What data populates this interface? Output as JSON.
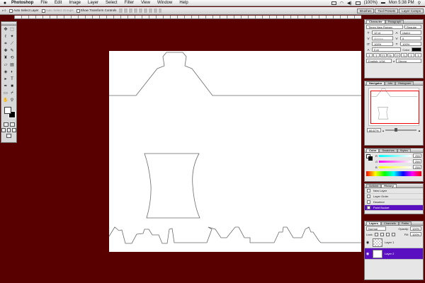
{
  "menubar": {
    "app_name": "Photoshop",
    "items": [
      "File",
      "Edit",
      "Image",
      "Layer",
      "Select",
      "Filter",
      "View",
      "Window",
      "Help"
    ],
    "battery": "(100%)",
    "clock": "Mon 5:38 PM"
  },
  "options_bar": {
    "auto_select_layer": "Auto Select Layer",
    "auto_select_groups": "Auto Select Groups",
    "show_transform_controls": "Show Transform Controls",
    "right_tabs": [
      "Brushes",
      "Tool Presets",
      "Layer Comps"
    ]
  },
  "toolbox": {
    "tool_icons": [
      "move-icon",
      "marquee-icon",
      "lasso-icon",
      "magic-wand-icon",
      "crop-icon",
      "slice-icon",
      "healing-icon",
      "brush-icon",
      "stamp-icon",
      "history-brush-icon",
      "eraser-icon",
      "gradient-icon",
      "blur-icon",
      "dodge-icon",
      "path-selection-icon",
      "type-icon",
      "pen-icon",
      "shape-icon",
      "notes-icon",
      "eyedropper-icon",
      "hand-icon",
      "zoom-icon"
    ],
    "foreground_color": "#ffffff",
    "background_color": "#000000"
  },
  "document": {
    "pasteboard_color": "#580000",
    "canvas_color": "#ffffff"
  },
  "character_panel": {
    "tabs": [
      "Character",
      "Paragraph"
    ],
    "font_family": "Times New Roman",
    "font_style": "Regular",
    "font_size": "12 pt",
    "leading": "(Auto)",
    "kerning": "Metrics",
    "tracking": "0",
    "vertical_scale": "100%",
    "horizontal_scale": "100%",
    "baseline_shift": "0 pt",
    "color_label": "Color:",
    "style_buttons": [
      "T",
      "T",
      "TT",
      "Tr",
      "T¹",
      "T₁",
      "T",
      "T"
    ],
    "language": "English: USA",
    "anti_alias_label": "a",
    "anti_alias": "Strong"
  },
  "navigator_panel": {
    "tabs": [
      "Navigator",
      "Info",
      "Histogram"
    ],
    "zoom": "66.67%"
  },
  "color_panel": {
    "tabs": [
      "Color",
      "Swatches",
      "Styles"
    ],
    "channels": [
      {
        "label": "R",
        "value": "255"
      },
      {
        "label": "G",
        "value": "255"
      },
      {
        "label": "B",
        "value": "255"
      }
    ]
  },
  "history_panel": {
    "tabs": [
      "Actions",
      "History"
    ],
    "items": [
      "New Layer",
      "Layer Order",
      "Deselect",
      "Paint Bucket"
    ],
    "active_index": 3,
    "active_color": "#5a10c0"
  },
  "layers_panel": {
    "tabs": [
      "Layers",
      "Channels",
      "Paths"
    ],
    "blend_mode": "Normal",
    "opacity_label": "Opacity:",
    "opacity": "100%",
    "lock_label": "Lock:",
    "fill_label": "Fill:",
    "fill": "100%",
    "layers": [
      {
        "name": "Layer 1",
        "visible": true
      },
      {
        "name": "Layer 2",
        "visible": true
      }
    ],
    "active_layer": "Layer 2"
  }
}
